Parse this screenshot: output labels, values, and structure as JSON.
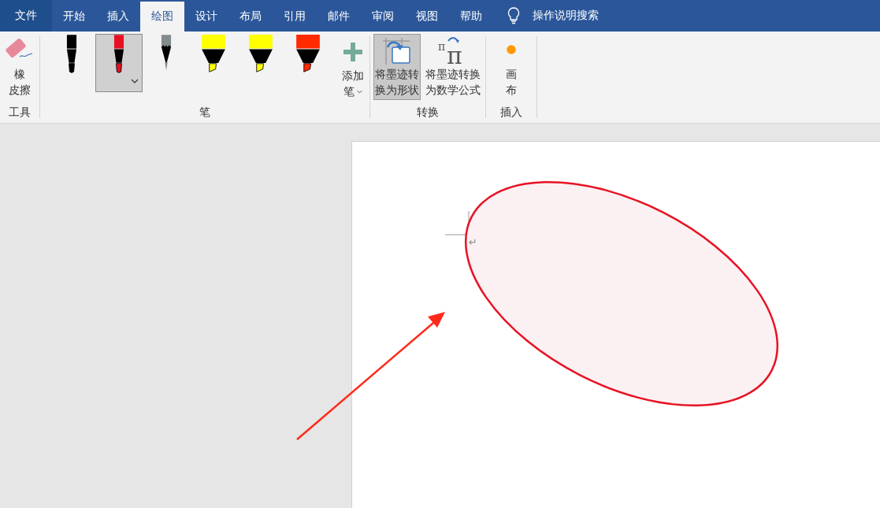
{
  "tabs": [
    {
      "label": "文件",
      "kind": "file",
      "selected": false
    },
    {
      "label": "开始",
      "kind": "tab",
      "selected": false
    },
    {
      "label": "插入",
      "kind": "tab",
      "selected": false
    },
    {
      "label": "绘图",
      "kind": "tab",
      "selected": true
    },
    {
      "label": "设计",
      "kind": "tab",
      "selected": false
    },
    {
      "label": "布局",
      "kind": "tab",
      "selected": false
    },
    {
      "label": "引用",
      "kind": "tab",
      "selected": false
    },
    {
      "label": "邮件",
      "kind": "tab",
      "selected": false
    },
    {
      "label": "审阅",
      "kind": "tab",
      "selected": false
    },
    {
      "label": "视图",
      "kind": "tab",
      "selected": false
    },
    {
      "label": "帮助",
      "kind": "tab",
      "selected": false
    }
  ],
  "search": {
    "label": "操作说明搜索"
  },
  "tools_group": {
    "label": "工具",
    "eraser": {
      "lines": [
        "橡",
        "皮擦"
      ]
    }
  },
  "pens_group": {
    "label": "笔",
    "pens": [
      {
        "kind": "pen",
        "color": "#000000",
        "selected": false
      },
      {
        "kind": "pen",
        "color": "#e81123",
        "selected": true
      },
      {
        "kind": "pencil",
        "color": "#838b8f",
        "selected": false
      },
      {
        "kind": "highlighter",
        "color": "#ffff00",
        "selected": false
      },
      {
        "kind": "highlighter",
        "color": "#ffff00",
        "selected": false
      },
      {
        "kind": "highlighter",
        "color": "#ff2a00",
        "selected": false
      }
    ],
    "add_pen": {
      "lines": [
        "添加",
        "笔"
      ]
    }
  },
  "convert_group": {
    "label": "转换",
    "buttons": [
      {
        "kind": "shape",
        "lines": [
          "将墨迹转",
          "换为形状"
        ],
        "selected": true
      },
      {
        "kind": "math",
        "lines": [
          "将墨迹转换",
          "为数学公式"
        ],
        "symbols": [
          "π",
          "π"
        ],
        "selected": false
      }
    ]
  },
  "insert_group": {
    "label": "插入",
    "canvas": {
      "lines": [
        "画",
        "布"
      ]
    }
  },
  "document": {
    "paragraph_mark": "↵"
  }
}
